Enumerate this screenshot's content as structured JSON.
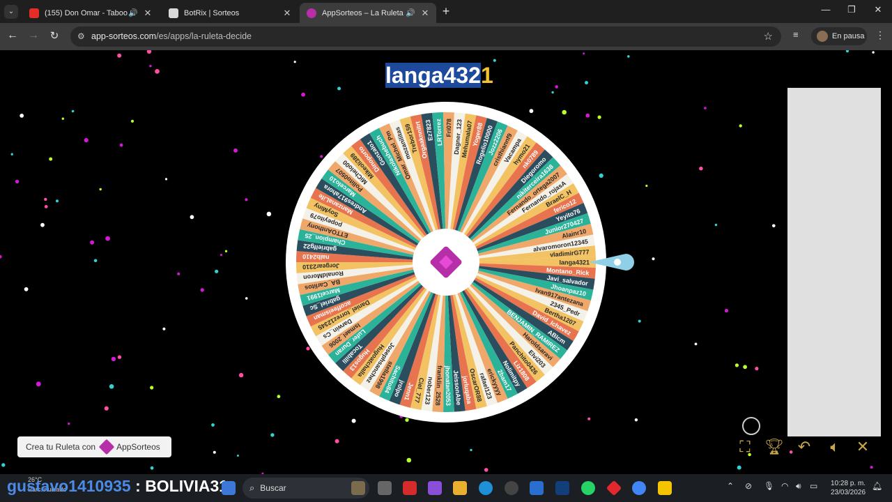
{
  "browser": {
    "tabs": [
      {
        "title": "(155) Don Omar - Taboo - Y",
        "favicon_color": "#e52d27",
        "active": false
      },
      {
        "title": "BotRix | Sorteos",
        "favicon_color": "#dddddd",
        "active": false
      },
      {
        "title": "AppSorteos – La Ruleta de",
        "favicon_color": "#b72fa8",
        "active": true
      }
    ],
    "url_host": "app-sorteos.com",
    "url_path": "/es/apps/la-ruleta-decide",
    "profile_label": "En pausa"
  },
  "wheel": {
    "winner_highlighted": "langa432",
    "winner_rest": "1",
    "entries": [
      "langa4321",
      "Montano_Rick",
      "Javi_salvador",
      "Jhoanpaz10",
      "Ivan917antezana",
      "2345_Pedr",
      "Bertha1207",
      "David_Ichavez",
      "ABIcm",
      "BENJAMIN_RAMIREZ",
      "Haroldsaravi",
      "Elvi203",
      "Panchito0426",
      "Liz1808",
      "Nolimitpy",
      "2bam17",
      "erickyyyy",
      "rafael123",
      "OscarOR88",
      "jorluqaba",
      "JeissonAbe",
      "jhonatan2053",
      "franklin_2528",
      "nober123",
      "Ciel_777",
      "Jenn1",
      "jrolpo",
      "Sachito84",
      "stella1998",
      "Josephsanchez",
      "Hugoatchalla",
      "Hugos13",
      "Tocabilli",
      "Lufer_Duran",
      "Ismael_2006",
      "Darwin_Cs",
      "Daniel_torrez12345",
      "acoffeeisman",
      "gabriel_Sc",
      "Marcel1991",
      "BA_Carlitos",
      "RonaldMoron",
      "Jorgear2310",
      "nalb2410",
      "gabrielfg22",
      "Champion_25",
      "ETTOAnthony",
      "popeyito79",
      "SoyMiny",
      "ManzanaLife",
      "Andres917ahora",
      "Marcelo10",
      "Pollito0507",
      "MiChelo00",
      "Mikeoli389",
      "Dinoporto",
      "Gonzalo1",
      "Nikolashebuch",
      "Omar_Michel_Pm",
      "mozanilitas",
      "Trebor159",
      "Orgaaknnitrt",
      "Ez7823",
      "LRTorrez",
      "Fri078",
      "Dagner_123",
      "Mehumala07",
      "Yoger88",
      "Rogelio10000",
      "Jozz2206",
      "cristhiannf9",
      "Vacampa",
      "hymo21",
      "nk0789",
      "Diegoromo",
      "nikiterceira1638",
      "Fernando_ortega2007",
      "Fernando_rojasA",
      "BraelC_H",
      "ferico12",
      "Yeyito76",
      "Junior270427",
      "Alainr10",
      "alvaromoron12345",
      "vladimirG777"
    ],
    "colors": [
      "#f3c262",
      "#e8734f",
      "#2a4e5e",
      "#2bb39a",
      "#f0a86a",
      "#f4f1e8"
    ]
  },
  "sidebar_ad": {},
  "promo": {
    "prefix": "Crea tu Ruleta con",
    "brand": "AppSorteos"
  },
  "controls": [
    "fullscreen-icon",
    "trophy-icon",
    "undo-icon",
    "volume-icon",
    "close-icon"
  ],
  "taskbar": {
    "weather_temp": "26°C",
    "weather_desc": "Parc. nublado",
    "overlay_user": "gustavo1410935",
    "overlay_sep": " : ",
    "overlay_msg": "BOLIVIA31",
    "search_placeholder": "Buscar",
    "time": "10:28 p. m.",
    "date": "23/03/2026"
  }
}
